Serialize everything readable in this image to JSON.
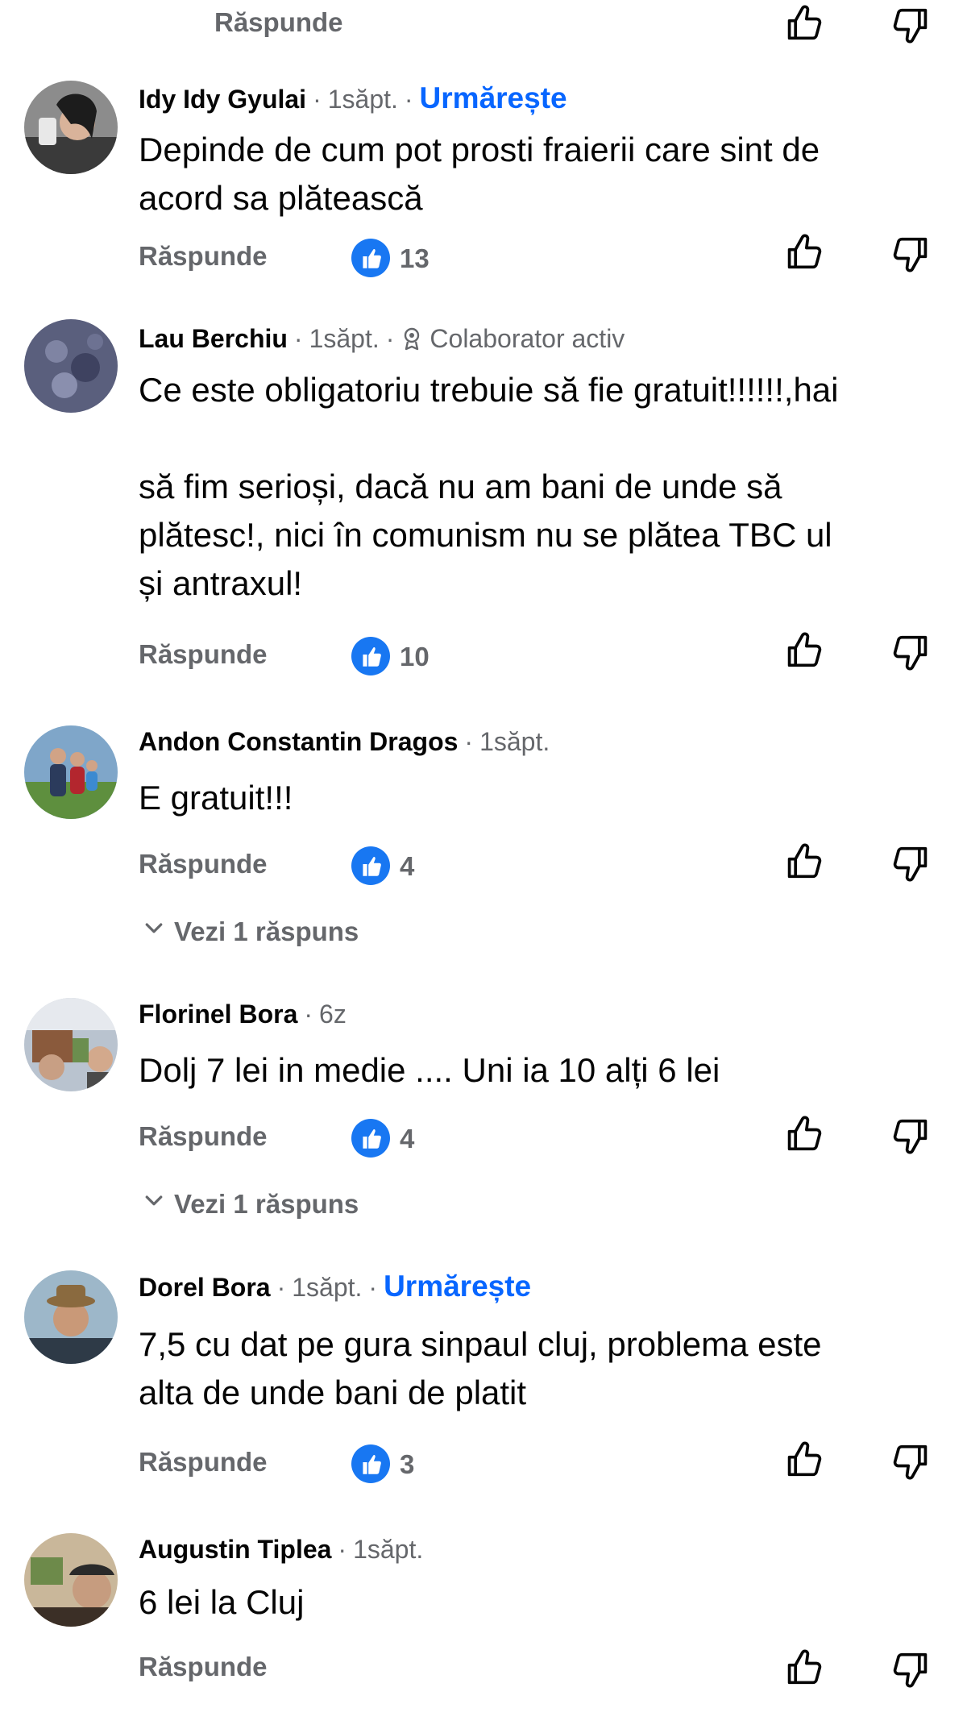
{
  "top": {
    "reply_label": "Răspunde"
  },
  "comments": [
    {
      "author": "Idy Idy Gyulai",
      "time": "1săpt.",
      "follow": "Urmărește",
      "text": "Depinde de cum pot prosti fraierii care sint de\nacord sa plătească",
      "reply_label": "Răspunde",
      "likes": "13"
    },
    {
      "author": "Lau Berchiu",
      "time": "1săpt.",
      "badge": "Colaborator activ",
      "text": "Ce este obligatoriu trebuie să fie gratuit!!!!!!,hai\n\nsă fim serioși, dacă nu am bani de unde să\nplătesc!, nici în comunism nu se plătea TBC ul\nși antraxul!",
      "reply_label": "Răspunde",
      "likes": "10"
    },
    {
      "author": "Andon Constantin Dragos",
      "time": "1săpt.",
      "text": "E gratuit!!!",
      "reply_label": "Răspunde",
      "likes": "4",
      "see_replies": "Vezi 1 răspuns"
    },
    {
      "author": "Florinel Bora",
      "time": "6z",
      "text": "Dolj 7 lei in medie .... Uni ia 10 alți 6 lei",
      "reply_label": "Răspunde",
      "likes": "4",
      "see_replies": "Vezi 1 răspuns"
    },
    {
      "author": "Dorel Bora",
      "time": "1săpt.",
      "follow": "Urmărește",
      "text": "7,5 cu dat pe gura sinpaul cluj, problema este\nalta de unde bani de platit",
      "reply_label": "Răspunde",
      "likes": "3"
    },
    {
      "author": "Augustin Tiplea",
      "time": "1săpt.",
      "text": "6 lei la Cluj",
      "reply_label": "Răspunde"
    }
  ],
  "icons": {
    "like_badge": "like-thumb-icon",
    "upvote": "thumbs-up-outline-icon",
    "downvote": "thumbs-down-outline-icon",
    "chevron": "chevron-down-icon",
    "badge": "contributor-badge-icon"
  },
  "colors": {
    "accent": "#0866ff",
    "like_badge": "#1877f2",
    "secondary_text": "#65676b",
    "primary_text": "#050505"
  }
}
